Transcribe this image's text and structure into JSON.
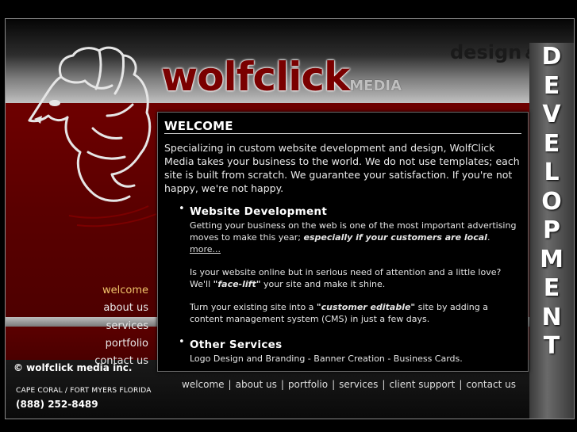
{
  "brand": {
    "name": "wolfclick",
    "sub": "MEDIA",
    "tagline": "design",
    "amp": "&",
    "vertical": [
      "D",
      "E",
      "V",
      "E",
      "L",
      "O",
      "P",
      "M",
      "E",
      "N",
      "T"
    ]
  },
  "content": {
    "heading": "WELCOME",
    "intro": "Specializing in custom website development and design, WolfClick Media takes your business to the world. We do not use templates; each site is built from scratch. We guarantee your satisfaction. If you're not happy, we're not happy.",
    "services": [
      {
        "title": "Website Development",
        "p1_pre": "Getting your business on the web is one of the most important advertising moves to make this year;",
        "p1_em": "especially if your customers are local",
        "p1_post": ".",
        "p1_more": "more...",
        "p2_pre": "Is your website online but in serious need of attention and a little love? We'll",
        "p2_em": "\"face-lift\"",
        "p2_post": "your site and make it shine.",
        "p3_pre": "Turn your existing site into a",
        "p3_em": "\"customer editable\"",
        "p3_post": "site by adding a content management system (CMS) in just a few days."
      },
      {
        "title": "Other Services",
        "p1": "Logo Design and Branding - Banner Creation - Business Cards."
      }
    ]
  },
  "nav": {
    "items": [
      "welcome",
      "about us",
      "services",
      "portfolio",
      "contact us"
    ]
  },
  "footer": {
    "copyright": "© wolfclick media inc.",
    "city": "CAPE CORAL / FORT MYERS FLORIDA",
    "phone": "(888) 252-8489",
    "links": [
      "welcome",
      "about us",
      "portfolio",
      "services",
      "client support",
      "contact us"
    ]
  },
  "colors": {
    "accent_red": "#6e0000",
    "nav_active": "#f0c36a"
  }
}
